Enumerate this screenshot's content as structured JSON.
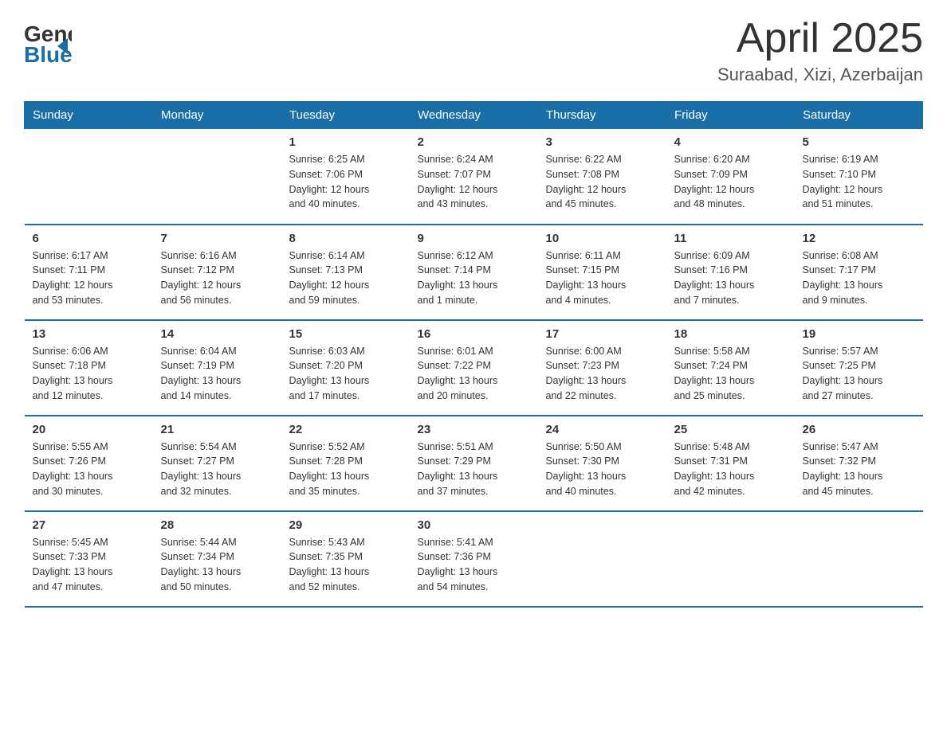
{
  "header": {
    "logo_general": "General",
    "logo_blue": "Blue",
    "title": "April 2025",
    "location": "Suraabad, Xizi, Azerbaijan"
  },
  "days_of_week": [
    "Sunday",
    "Monday",
    "Tuesday",
    "Wednesday",
    "Thursday",
    "Friday",
    "Saturday"
  ],
  "weeks": [
    [
      {
        "day": "",
        "info": ""
      },
      {
        "day": "",
        "info": ""
      },
      {
        "day": "1",
        "info": "Sunrise: 6:25 AM\nSunset: 7:06 PM\nDaylight: 12 hours\nand 40 minutes."
      },
      {
        "day": "2",
        "info": "Sunrise: 6:24 AM\nSunset: 7:07 PM\nDaylight: 12 hours\nand 43 minutes."
      },
      {
        "day": "3",
        "info": "Sunrise: 6:22 AM\nSunset: 7:08 PM\nDaylight: 12 hours\nand 45 minutes."
      },
      {
        "day": "4",
        "info": "Sunrise: 6:20 AM\nSunset: 7:09 PM\nDaylight: 12 hours\nand 48 minutes."
      },
      {
        "day": "5",
        "info": "Sunrise: 6:19 AM\nSunset: 7:10 PM\nDaylight: 12 hours\nand 51 minutes."
      }
    ],
    [
      {
        "day": "6",
        "info": "Sunrise: 6:17 AM\nSunset: 7:11 PM\nDaylight: 12 hours\nand 53 minutes."
      },
      {
        "day": "7",
        "info": "Sunrise: 6:16 AM\nSunset: 7:12 PM\nDaylight: 12 hours\nand 56 minutes."
      },
      {
        "day": "8",
        "info": "Sunrise: 6:14 AM\nSunset: 7:13 PM\nDaylight: 12 hours\nand 59 minutes."
      },
      {
        "day": "9",
        "info": "Sunrise: 6:12 AM\nSunset: 7:14 PM\nDaylight: 13 hours\nand 1 minute."
      },
      {
        "day": "10",
        "info": "Sunrise: 6:11 AM\nSunset: 7:15 PM\nDaylight: 13 hours\nand 4 minutes."
      },
      {
        "day": "11",
        "info": "Sunrise: 6:09 AM\nSunset: 7:16 PM\nDaylight: 13 hours\nand 7 minutes."
      },
      {
        "day": "12",
        "info": "Sunrise: 6:08 AM\nSunset: 7:17 PM\nDaylight: 13 hours\nand 9 minutes."
      }
    ],
    [
      {
        "day": "13",
        "info": "Sunrise: 6:06 AM\nSunset: 7:18 PM\nDaylight: 13 hours\nand 12 minutes."
      },
      {
        "day": "14",
        "info": "Sunrise: 6:04 AM\nSunset: 7:19 PM\nDaylight: 13 hours\nand 14 minutes."
      },
      {
        "day": "15",
        "info": "Sunrise: 6:03 AM\nSunset: 7:20 PM\nDaylight: 13 hours\nand 17 minutes."
      },
      {
        "day": "16",
        "info": "Sunrise: 6:01 AM\nSunset: 7:22 PM\nDaylight: 13 hours\nand 20 minutes."
      },
      {
        "day": "17",
        "info": "Sunrise: 6:00 AM\nSunset: 7:23 PM\nDaylight: 13 hours\nand 22 minutes."
      },
      {
        "day": "18",
        "info": "Sunrise: 5:58 AM\nSunset: 7:24 PM\nDaylight: 13 hours\nand 25 minutes."
      },
      {
        "day": "19",
        "info": "Sunrise: 5:57 AM\nSunset: 7:25 PM\nDaylight: 13 hours\nand 27 minutes."
      }
    ],
    [
      {
        "day": "20",
        "info": "Sunrise: 5:55 AM\nSunset: 7:26 PM\nDaylight: 13 hours\nand 30 minutes."
      },
      {
        "day": "21",
        "info": "Sunrise: 5:54 AM\nSunset: 7:27 PM\nDaylight: 13 hours\nand 32 minutes."
      },
      {
        "day": "22",
        "info": "Sunrise: 5:52 AM\nSunset: 7:28 PM\nDaylight: 13 hours\nand 35 minutes."
      },
      {
        "day": "23",
        "info": "Sunrise: 5:51 AM\nSunset: 7:29 PM\nDaylight: 13 hours\nand 37 minutes."
      },
      {
        "day": "24",
        "info": "Sunrise: 5:50 AM\nSunset: 7:30 PM\nDaylight: 13 hours\nand 40 minutes."
      },
      {
        "day": "25",
        "info": "Sunrise: 5:48 AM\nSunset: 7:31 PM\nDaylight: 13 hours\nand 42 minutes."
      },
      {
        "day": "26",
        "info": "Sunrise: 5:47 AM\nSunset: 7:32 PM\nDaylight: 13 hours\nand 45 minutes."
      }
    ],
    [
      {
        "day": "27",
        "info": "Sunrise: 5:45 AM\nSunset: 7:33 PM\nDaylight: 13 hours\nand 47 minutes."
      },
      {
        "day": "28",
        "info": "Sunrise: 5:44 AM\nSunset: 7:34 PM\nDaylight: 13 hours\nand 50 minutes."
      },
      {
        "day": "29",
        "info": "Sunrise: 5:43 AM\nSunset: 7:35 PM\nDaylight: 13 hours\nand 52 minutes."
      },
      {
        "day": "30",
        "info": "Sunrise: 5:41 AM\nSunset: 7:36 PM\nDaylight: 13 hours\nand 54 minutes."
      },
      {
        "day": "",
        "info": ""
      },
      {
        "day": "",
        "info": ""
      },
      {
        "day": "",
        "info": ""
      }
    ]
  ]
}
